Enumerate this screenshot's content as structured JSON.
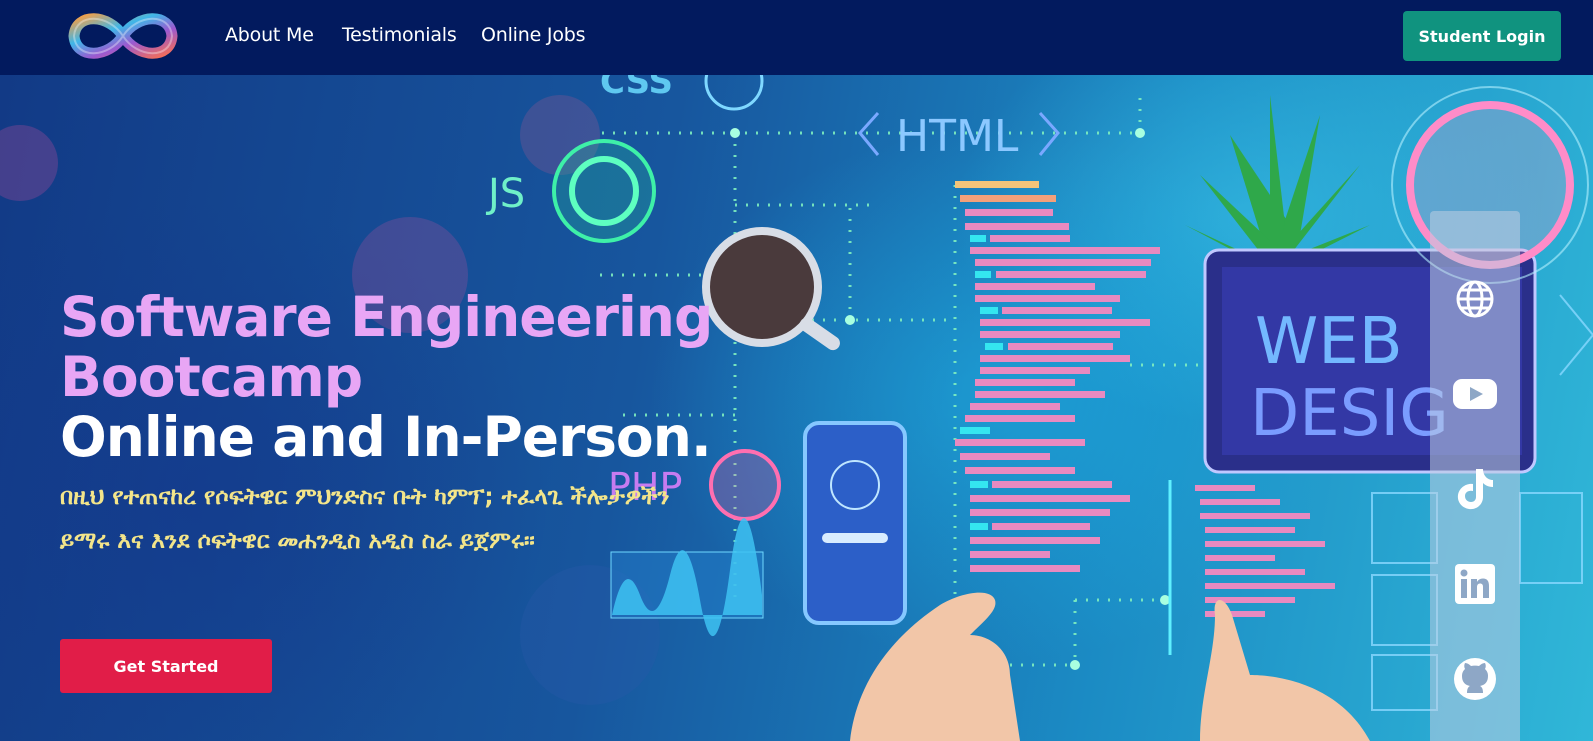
{
  "nav": {
    "logo_icon": "infinity-logo",
    "links": [
      {
        "label": "About Me"
      },
      {
        "label": "Testimonials"
      },
      {
        "label": "Online Jobs"
      }
    ],
    "login_label": "Student Login"
  },
  "hero": {
    "title_line1": "Software Engineering",
    "title_line2": "Bootcamp",
    "title_line3": "Online and In-Person.",
    "subtitle": "በዚህ የተጠናከረ የሶፍትዌር ምህንድስና ቡት ካምፕ; ተፈላጊ ችሎታዎችን ይማሩ እና እንደ ሶፍትዌር መሐንዲስ አዲስ ስራ ይጀምሩ።",
    "cta_label": "Get Started",
    "background_text": {
      "css": "CSS",
      "html": "HTML",
      "js": "JS",
      "php": "PHP",
      "web": "WEB",
      "design": "DESIG"
    }
  },
  "social": [
    {
      "icon": "globe-icon"
    },
    {
      "icon": "youtube-icon"
    },
    {
      "icon": "tiktok-icon"
    },
    {
      "icon": "linkedin-icon"
    },
    {
      "icon": "github-icon"
    }
  ],
  "colors": {
    "nav_bg": "#021a5e",
    "login_btn": "#10937f",
    "cta_btn": "#e11d48",
    "title_pink": "#e8a6f5",
    "subtitle_yellow": "#f3e58a"
  }
}
